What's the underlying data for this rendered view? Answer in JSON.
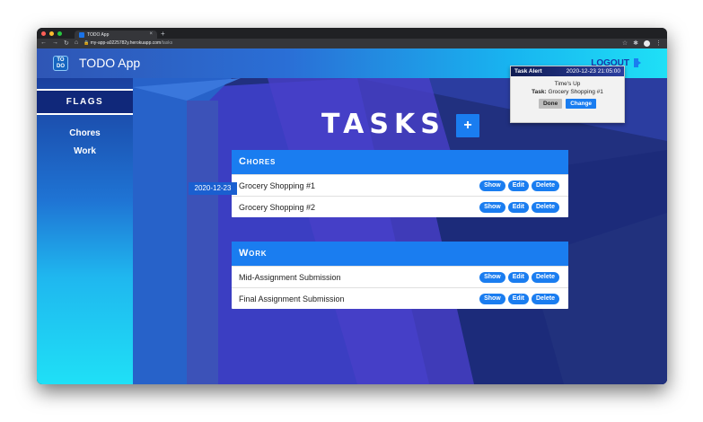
{
  "browser": {
    "tab_title": "TODO App",
    "tab_close": "×",
    "new_tab": "+",
    "url_host": "my-app-a0225782y.herokuapp.com",
    "url_path": "/tasks",
    "icons": [
      "back-icon",
      "forward-icon",
      "reload-icon",
      "home-icon",
      "lock-icon",
      "star-icon",
      "extension-icon",
      "profile-icon",
      "menu-icon"
    ]
  },
  "header": {
    "logo_text": "TO DO",
    "app_title": "TODO App",
    "logout_label": "LOGOUT"
  },
  "sidebar": {
    "heading": "FLAGS",
    "items": [
      {
        "label": "Chores"
      },
      {
        "label": "Work"
      }
    ]
  },
  "main": {
    "title": "TASKS",
    "add_button": "+",
    "date_flag": "2020-12-23",
    "buttons": {
      "show": "Show",
      "edit": "Edit",
      "delete": "Delete"
    },
    "groups": [
      {
        "name": "Chores",
        "tasks": [
          "Grocery Shopping #1",
          "Grocery Shopping #2"
        ]
      },
      {
        "name": "Work",
        "tasks": [
          "Mid-Assignment Submission",
          "Final Assignment Submission"
        ]
      }
    ]
  },
  "alert": {
    "title": "Task Alert",
    "time": "2020-12-23 21:05:00",
    "message": "Time's Up",
    "task_label": "Task:",
    "task_name": "Grocery Shopping #1",
    "done_label": "Done",
    "change_label": "Change"
  },
  "colors": {
    "accent": "#1a7df0",
    "sidebar_heading_bg": "#10287a",
    "gradient_end": "#1fe0f6"
  }
}
